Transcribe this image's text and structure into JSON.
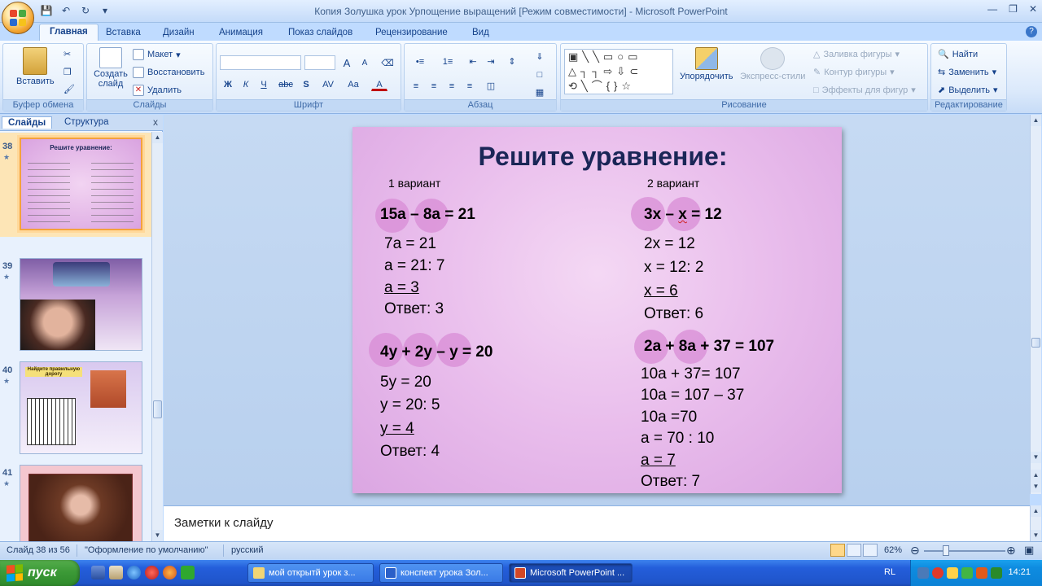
{
  "window": {
    "title": "Копия Золушка урок Урпощение выращений [Режим совместимости] - Microsoft PowerPoint"
  },
  "tabs": [
    "Главная",
    "Вставка",
    "Дизайн",
    "Анимация",
    "Показ слайдов",
    "Рецензирование",
    "Вид"
  ],
  "ribbon": {
    "clipboard": {
      "name": "Буфер обмена",
      "paste": "Вставить"
    },
    "slides": {
      "name": "Слайды",
      "new_slide": "Создать слайд",
      "layout": "Макет",
      "reset": "Восстановить",
      "delete": "Удалить"
    },
    "font": {
      "name": "Шрифт",
      "bold": "Ж",
      "italic": "К",
      "underline": "Ч",
      "strike": "abc",
      "shadow": "S",
      "spacing": "AV",
      "case": "Aa",
      "color": "A",
      "grow": "A",
      "shrink": "A"
    },
    "paragraph": {
      "name": "Абзац"
    },
    "drawing": {
      "name": "Рисование",
      "arrange": "Упорядочить",
      "quick_styles": "Экспресс-стили",
      "fill": "Заливка фигуры",
      "outline": "Контур фигуры",
      "effects": "Эффекты для фигур"
    },
    "editing": {
      "name": "Редактирование",
      "find": "Найти",
      "replace": "Заменить",
      "select": "Выделить"
    }
  },
  "left_pane": {
    "tabs": [
      "Слайды",
      "Структура"
    ],
    "close": "x",
    "slides": [
      {
        "num": "38",
        "title": "Решите уравнение:"
      },
      {
        "num": "39"
      },
      {
        "num": "40",
        "title": "Найдите правильную дорогу"
      },
      {
        "num": "41"
      }
    ]
  },
  "slide": {
    "title": "Решите уравнение:",
    "variant1": "1 вариант",
    "variant2": "2 вариант",
    "v1_eq1": {
      "a": "15a",
      "op": " – ",
      "b": "8a",
      "rest": " = 21"
    },
    "v1_eq1_steps": [
      "7a = 21",
      "a = 21: 7",
      "a = 3",
      "Ответ: 3"
    ],
    "v1_eq2": {
      "a": "4y",
      "op1": " + ",
      "b": "2y",
      "op2": " – ",
      "c": "y",
      "rest": " = 20"
    },
    "v1_eq2_steps": [
      "5y = 20",
      "y = 20: 5",
      "y = 4",
      "Ответ: 4"
    ],
    "v2_eq1": {
      "a": "3x",
      "op": " – ",
      "b": "x",
      "rest": " = 12"
    },
    "v2_eq1_steps": [
      "2x = 12",
      "x = 12: 2",
      "x = 6",
      "Ответ: 6"
    ],
    "v2_eq2": {
      "a": "2a",
      "op": " + ",
      "b": "8a",
      "rest": " + 37 = 107"
    },
    "v2_eq2_steps": [
      "10a + 37= 107",
      "10a = 107 – 37",
      "10a =70",
      "a = 70 : 10",
      "a = 7",
      "Ответ: 7"
    ]
  },
  "notes": {
    "placeholder": "Заметки к слайду"
  },
  "status": {
    "slide": "Слайд 38 из 56",
    "theme": "\"Оформление по умолчанию\"",
    "lang": "русский",
    "zoom": "62%",
    "zoom_level": 0.62
  },
  "taskbar": {
    "start": "пуск",
    "tasks": [
      "мой открытй урок з...",
      "конспект урока Зол...",
      "Microsoft PowerPoint ..."
    ],
    "lang": "RL",
    "clock": "14:21"
  },
  "colors": {
    "accent": "#f4a23c",
    "slide_title": "#1a2657",
    "circle": "#d88cd6"
  }
}
